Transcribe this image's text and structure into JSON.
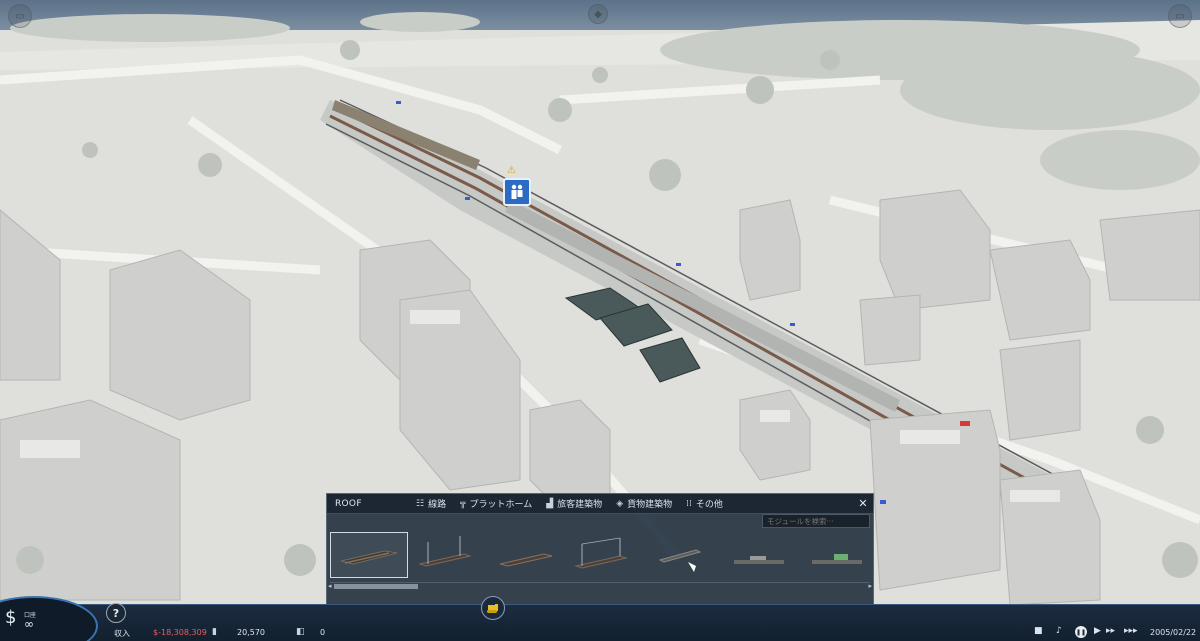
{
  "station_marker": {
    "icon": "station-people-icon",
    "badge": "⚠"
  },
  "panel": {
    "title": "ROOF",
    "tabs": [
      {
        "icon": "track-icon",
        "label": "線路"
      },
      {
        "icon": "platform-icon",
        "label": "プラットホーム"
      },
      {
        "icon": "passenger-building-icon",
        "label": "旅客建築物"
      },
      {
        "icon": "freight-building-icon",
        "label": "貨物建築物"
      },
      {
        "icon": "grid-icon",
        "label": "その他"
      }
    ],
    "close_label": "✕",
    "search_placeholder": "モジュールを検索···",
    "modules": [
      "roof-module",
      "roof-module",
      "roof-module",
      "roof-module",
      "roof-module",
      "roof-module",
      "roof-module"
    ]
  },
  "bottom_bar": {
    "money_label": "口座",
    "money_value": "∞",
    "help_label": "?",
    "income_label": "収入",
    "income_value": "$-18,308,309",
    "stat_value": "20,570",
    "train_count": "0",
    "date": "2005/02/22"
  },
  "colors": {
    "bar_bg": "#1c2c40",
    "panel_bg": "#26344a",
    "accent": "#3a74b0",
    "negative": "#e06060",
    "station_marker": "#2c6bc4"
  }
}
